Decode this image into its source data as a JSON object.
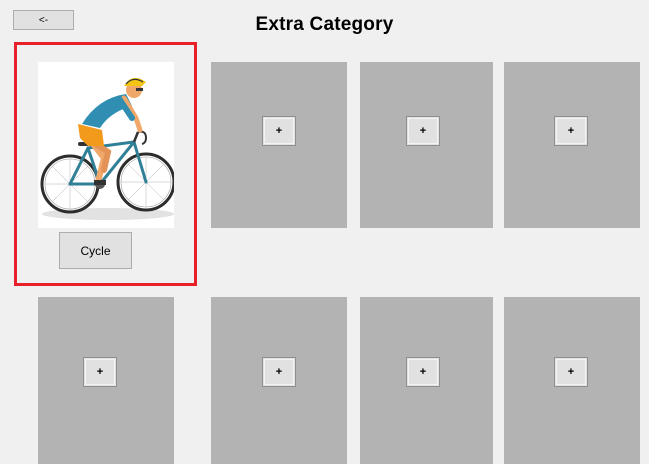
{
  "window": {
    "title": "Extra Category"
  },
  "toolbar": {
    "back_label": "<-"
  },
  "category_card": {
    "label": "Cycle",
    "image_icon": "cyclist-image"
  },
  "slots": {
    "add_label": "+"
  },
  "colors": {
    "highlight": "#e8202a",
    "slot_bg": "#b3b3b3",
    "button_bg": "#e1e1e1",
    "window_bg": "#f0f0f0"
  }
}
